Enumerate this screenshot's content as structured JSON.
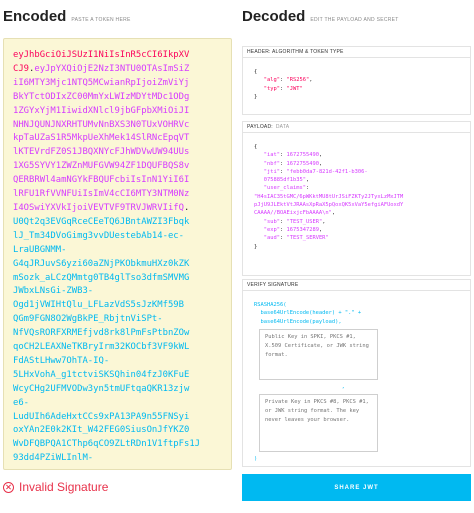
{
  "encoded": {
    "title": "Encoded",
    "subtitle": "PASTE A TOKEN HERE",
    "header_lines": [
      "eyJhbGciOiJSUzI1NiIsInR5cCI6IkpXV",
      "CJ9"
    ],
    "header_tail_dot": ".",
    "payload_first": "eyJpYXQiOjE2NzI3NTU0OTAsImSiZ",
    "payload_lines": [
      "iI6MTY3Mjc1NTQ5MCwianRpIjoiZmViYj",
      "BkYTctODIxZC00MmYxLWIzMDYtMDc1ODg",
      "1ZGYxYjM1IiwidXNlcl9jbGFpbXMiOiJI",
      "NHNJQUNJNXRHTUMvNnBXS3N0TUxVOHRVc",
      "kpTaUZaS1R5MkpUeXhMek14SlRNcEpqVT",
      "lKTEVrdFZ0S1JBQXNYcFJhWDVwUW94UUs",
      "1XG5SYVY1ZWZnMUFGVW94ZF1DQUFBQS8v",
      "QERBRWl4amNGYkFBQUFcbiIsInN1YiI6I",
      "lRFU1RfVVNFUiIsImV4cCI6MTY3NTM0Nz",
      "I4OSwiYXVkIjoiVEVTVF9TRVJWRVIifQ"
    ],
    "payload_tail_dot": ".",
    "signature_lines": [
      "U0Qt2q3EVGqRceCEeTQ6JBntAWZI3Fbqk",
      "lJ_Tm34DVoGimg3vvDUestebAb14-ec-",
      "LraUBGNMM-",
      "G4qJRJuvS6yzi60aZNjPKObkmuHXz0kZK",
      "mSozk_aLCzQMmtg0TB4glTso3dfmSMVMG",
      "JWbxLNsGi-ZWB3-",
      "Ogd1jVWIHtQlu_LFLazVdS5sJzKMf59B",
      "QGm9FGN8O2WgBkPE_RbjtnViSPt-",
      "NfVQsRORFXRMEfjvd8rk8lPmFsPtbnZOw",
      "qoCH2LEAXNeTKBryIrm32KOCbf3VF9kWL",
      "FdAStLHww7OhTA-IQ-",
      "5LHxVohA_g1tctviSKSQhin04fzJ0KFuE",
      "WcyCHg2UFMVODw3yn5tmUFtqaQKR13zjw",
      "e6-",
      "LudUIh6AdeHxtCCs9xPA13PA9n55FNSyi",
      "oxYAn2E0k2KIt_W42FEG0SiusOnJfYKZ0",
      "WvDFQBPQA1CThp6qCO9ZLtRDn1V1ftpFs1J",
      "93dd4PZiWLInlM-"
    ],
    "status_text": "Invalid Signature"
  },
  "decoded": {
    "title": "Decoded",
    "subtitle": "EDIT THE PAYLOAD AND SECRET",
    "header_panel": {
      "label": "HEADER: ALGORITHM & TOKEN TYPE",
      "open": "{",
      "fields": [
        {
          "key": "\"alg\"",
          "value": "\"RS256\"",
          "comma": ","
        },
        {
          "key": "\"typ\"",
          "value": "\"JWT\"",
          "comma": ""
        }
      ],
      "close": "}"
    },
    "payload_panel": {
      "label": "PAYLOAD:",
      "sublabel": "DATA",
      "open": "{",
      "fields": [
        {
          "key": "\"iat\"",
          "value": "1672755490",
          "comma": ","
        },
        {
          "key": "\"nbf\"",
          "value": "1672755490",
          "comma": ","
        },
        {
          "key": "\"jti\"",
          "value": "\"febb0da7-821d-42f1-b306-",
          "comma": ""
        },
        {
          "key": "",
          "value": "075885df1b35\"",
          "comma": ","
        },
        {
          "key": "\"user_claims\"",
          "value": "",
          "comma": ""
        },
        {
          "key": "",
          "value": "\"H4sIAC35tGMC/6pWKktMU8tUrJSiFZKTy2JTyxLzMxJTM",
          "comma": ""
        },
        {
          "key": "",
          "value": "pJjU9JLEktVtJRAAsXpRaX5pQoxQK5xVaY5efgiAFUoxdY",
          "comma": ""
        },
        {
          "key": "",
          "value": "CAAAA//BOAEixjcFbAAAA\\n\"",
          "comma": ","
        },
        {
          "key": "\"sub\"",
          "value": "\"TEST_USER\"",
          "comma": ","
        },
        {
          "key": "\"exp\"",
          "value": "1675347289",
          "comma": ","
        },
        {
          "key": "\"aud\"",
          "value": "\"TEST_SERVER\"",
          "comma": ""
        }
      ],
      "close": "}"
    },
    "verify_panel": {
      "label": "VERIFY SIGNATURE",
      "line1": "RSASHA256(",
      "line2": "base64UrlEncode(header) + \".\" +",
      "line3": "base64UrlEncode(payload),",
      "public_key_placeholder": "Public Key in SPKI, PKCS #1, X.509 Certificate, or JWK string format.",
      "trailing_comma": ",",
      "private_key_placeholder": "Private Key in PKCS #8, PKCS #1, or JWK string format. The key never leaves your browser.",
      "closing": ")"
    },
    "share_button": "SHARE JWT"
  }
}
